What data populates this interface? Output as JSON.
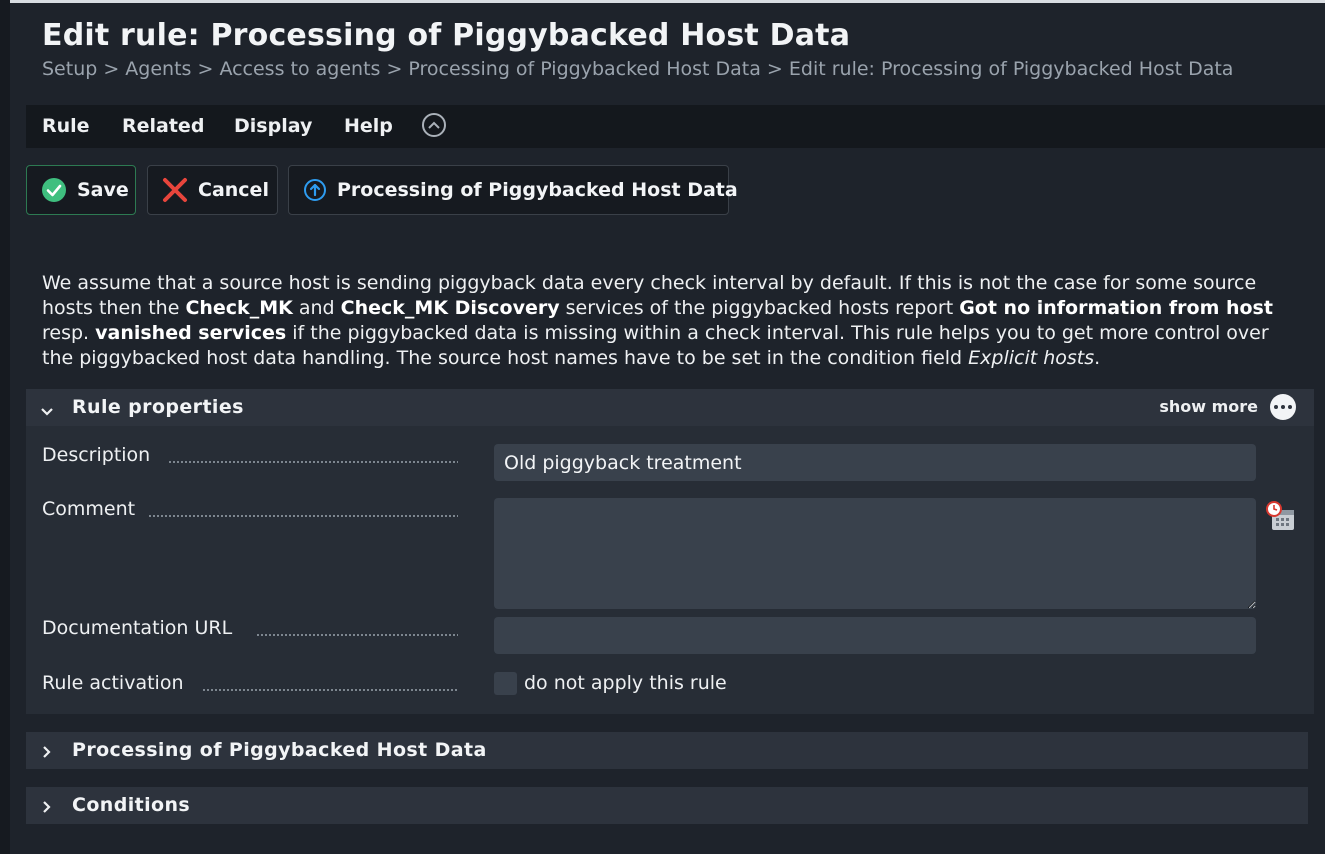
{
  "page": {
    "title": "Edit rule: Processing of Piggybacked Host Data",
    "breadcrumb": "Setup > Agents > Access to agents > Processing of Piggybacked Host Data > Edit rule: Processing of Piggybacked Host Data"
  },
  "menu": {
    "items": [
      "Rule",
      "Related",
      "Display",
      "Help"
    ]
  },
  "toolbar": {
    "save_label": "Save",
    "cancel_label": "Cancel",
    "ruleset_label": "Processing of Piggybacked Host Data"
  },
  "intro": {
    "t1": "We assume that a source host is sending piggyback data every check interval by default. If this is not the case for some source hosts then the ",
    "b1": "Check_MK",
    "t2": " and ",
    "b2": "Check_MK Discovery",
    "t3": " services of the piggybacked hosts report ",
    "b3": "Got no information from host",
    "t4": " resp. ",
    "b4": "vanished services",
    "t5": " if the piggybacked data is missing within a check interval. This rule helps you to get more control over the piggybacked host data handling. The source host names have to be set in the condition field ",
    "i1": "Explicit hosts",
    "t6": "."
  },
  "rule_properties": {
    "title": "Rule properties",
    "show_more": "show more",
    "description_label": "Description",
    "description_value": "Old piggyback treatment",
    "comment_label": "Comment",
    "comment_value": "",
    "doc_url_label": "Documentation URL",
    "doc_url_value": "",
    "activation_label": "Rule activation",
    "activation_checkbox_label": "do not apply this rule",
    "activation_checked": false
  },
  "sections": {
    "value_title": "Processing of Piggybacked Host Data",
    "conditions_title": "Conditions"
  },
  "colors": {
    "background": "#1e232b",
    "menubar": "#14181d",
    "section_header": "#2d333d",
    "input": "#39414c",
    "save_icon": "#3fbf7f",
    "cancel_icon": "#e8453c",
    "ruleset_icon": "#2e9cf0"
  }
}
